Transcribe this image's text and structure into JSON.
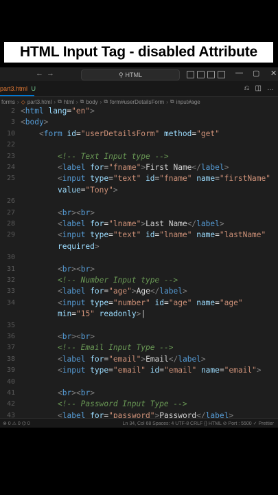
{
  "banner": {
    "title": "HTML Input Tag - disabled Attribute"
  },
  "window": {
    "search_text": "HTML",
    "back_icon": "arrow-left-icon",
    "forward_icon": "arrow-right-icon",
    "search_icon": "search-icon"
  },
  "tabs": {
    "left_label": "forms",
    "active_file": "part3.html",
    "modified": "U"
  },
  "breadcrumb": {
    "items": [
      "forms",
      "part3.html",
      "html",
      "body",
      "form#userDetailsForm",
      "input#age"
    ]
  },
  "code_lines": [
    {
      "num": "2",
      "indent": 0,
      "tokens": [
        [
          "t-punc",
          "<"
        ],
        [
          "t-tag",
          "html"
        ],
        [
          "t-plain",
          " "
        ],
        [
          "t-attr",
          "lang"
        ],
        [
          "t-plain",
          "="
        ],
        [
          "t-str",
          "\"en\""
        ],
        [
          "t-punc",
          ">"
        ]
      ]
    },
    {
      "num": "3",
      "indent": 0,
      "tokens": [
        [
          "t-punc",
          "<"
        ],
        [
          "t-tag",
          "body"
        ],
        [
          "t-punc",
          ">"
        ]
      ]
    },
    {
      "num": "10",
      "indent": 1,
      "tokens": [
        [
          "t-punc",
          "<"
        ],
        [
          "t-tag",
          "form"
        ],
        [
          "t-plain",
          " "
        ],
        [
          "t-attr",
          "id"
        ],
        [
          "t-plain",
          "="
        ],
        [
          "t-str",
          "\"userDetailsForm\""
        ],
        [
          "t-plain",
          " "
        ],
        [
          "t-attr",
          "method"
        ],
        [
          "t-plain",
          "="
        ],
        [
          "t-str",
          "\"get\""
        ]
      ]
    },
    {
      "num": "22",
      "indent": 0,
      "tokens": []
    },
    {
      "num": "23",
      "indent": 2,
      "tokens": [
        [
          "t-com",
          "<!-- Text Input type -->"
        ]
      ]
    },
    {
      "num": "24",
      "indent": 2,
      "tokens": [
        [
          "t-punc",
          "<"
        ],
        [
          "t-tag",
          "label"
        ],
        [
          "t-plain",
          " "
        ],
        [
          "t-attr",
          "for"
        ],
        [
          "t-plain",
          "="
        ],
        [
          "t-str",
          "\"fname\""
        ],
        [
          "t-punc",
          ">"
        ],
        [
          "t-plain",
          "First Name"
        ],
        [
          "t-punc",
          "</"
        ],
        [
          "t-tag",
          "label"
        ],
        [
          "t-punc",
          ">"
        ]
      ]
    },
    {
      "num": "25",
      "indent": 2,
      "tokens": [
        [
          "t-punc",
          "<"
        ],
        [
          "t-tag",
          "input"
        ],
        [
          "t-plain",
          " "
        ],
        [
          "t-attr",
          "type"
        ],
        [
          "t-plain",
          "="
        ],
        [
          "t-str",
          "\"text\""
        ],
        [
          "t-plain",
          " "
        ],
        [
          "t-attr",
          "id"
        ],
        [
          "t-plain",
          "="
        ],
        [
          "t-str",
          "\"fname\""
        ],
        [
          "t-plain",
          " "
        ],
        [
          "t-attr",
          "name"
        ],
        [
          "t-plain",
          "="
        ],
        [
          "t-str",
          "\"firstName\""
        ]
      ]
    },
    {
      "num": "",
      "indent": 2,
      "tokens": [
        [
          "t-attr",
          "value"
        ],
        [
          "t-plain",
          "="
        ],
        [
          "t-str",
          "\"Tony\""
        ],
        [
          "t-punc",
          ">"
        ]
      ]
    },
    {
      "num": "26",
      "indent": 0,
      "tokens": []
    },
    {
      "num": "27",
      "indent": 2,
      "tokens": [
        [
          "t-punc",
          "<"
        ],
        [
          "t-tag",
          "br"
        ],
        [
          "t-punc",
          "><"
        ],
        [
          "t-tag",
          "br"
        ],
        [
          "t-punc",
          ">"
        ]
      ]
    },
    {
      "num": "28",
      "indent": 2,
      "tokens": [
        [
          "t-punc",
          "<"
        ],
        [
          "t-tag",
          "label"
        ],
        [
          "t-plain",
          " "
        ],
        [
          "t-attr",
          "for"
        ],
        [
          "t-plain",
          "="
        ],
        [
          "t-str",
          "\"lname\""
        ],
        [
          "t-punc",
          ">"
        ],
        [
          "t-plain",
          "Last Name"
        ],
        [
          "t-punc",
          "</"
        ],
        [
          "t-tag",
          "label"
        ],
        [
          "t-punc",
          ">"
        ]
      ]
    },
    {
      "num": "29",
      "indent": 2,
      "tokens": [
        [
          "t-punc",
          "<"
        ],
        [
          "t-tag",
          "input"
        ],
        [
          "t-plain",
          " "
        ],
        [
          "t-attr",
          "type"
        ],
        [
          "t-plain",
          "="
        ],
        [
          "t-str",
          "\"text\""
        ],
        [
          "t-plain",
          " "
        ],
        [
          "t-attr",
          "id"
        ],
        [
          "t-plain",
          "="
        ],
        [
          "t-str",
          "\"lname\""
        ],
        [
          "t-plain",
          " "
        ],
        [
          "t-attr",
          "name"
        ],
        [
          "t-plain",
          "="
        ],
        [
          "t-str",
          "\"lastName\""
        ]
      ]
    },
    {
      "num": "",
      "indent": 2,
      "tokens": [
        [
          "t-attr",
          "required"
        ],
        [
          "t-punc",
          ">"
        ]
      ]
    },
    {
      "num": "30",
      "indent": 0,
      "tokens": []
    },
    {
      "num": "31",
      "indent": 2,
      "tokens": [
        [
          "t-punc",
          "<"
        ],
        [
          "t-tag",
          "br"
        ],
        [
          "t-punc",
          "><"
        ],
        [
          "t-tag",
          "br"
        ],
        [
          "t-punc",
          ">"
        ]
      ]
    },
    {
      "num": "32",
      "indent": 2,
      "tokens": [
        [
          "t-com",
          "<!-- Number Input type -->"
        ]
      ]
    },
    {
      "num": "33",
      "indent": 2,
      "tokens": [
        [
          "t-punc",
          "<"
        ],
        [
          "t-tag",
          "label"
        ],
        [
          "t-plain",
          " "
        ],
        [
          "t-attr",
          "for"
        ],
        [
          "t-plain",
          "="
        ],
        [
          "t-str",
          "\"age\""
        ],
        [
          "t-punc",
          ">"
        ],
        [
          "t-plain",
          "Age"
        ],
        [
          "t-punc",
          "</"
        ],
        [
          "t-tag",
          "label"
        ],
        [
          "t-punc",
          ">"
        ]
      ]
    },
    {
      "num": "34",
      "indent": 2,
      "tokens": [
        [
          "t-punc",
          "<"
        ],
        [
          "t-tag",
          "input"
        ],
        [
          "t-plain",
          " "
        ],
        [
          "t-attr",
          "type"
        ],
        [
          "t-plain",
          "="
        ],
        [
          "t-str",
          "\"number\""
        ],
        [
          "t-plain",
          " "
        ],
        [
          "t-attr",
          "id"
        ],
        [
          "t-plain",
          "="
        ],
        [
          "t-str",
          "\"age\""
        ],
        [
          "t-plain",
          " "
        ],
        [
          "t-attr",
          "name"
        ],
        [
          "t-plain",
          "="
        ],
        [
          "t-str",
          "\"age\""
        ]
      ]
    },
    {
      "num": "",
      "indent": 2,
      "tokens": [
        [
          "t-attr",
          "min"
        ],
        [
          "t-plain",
          "="
        ],
        [
          "t-str",
          "\"15\""
        ],
        [
          "t-plain",
          " "
        ],
        [
          "t-attr",
          "readonly"
        ],
        [
          "t-punc",
          ">"
        ],
        [
          "t-plain",
          "|"
        ]
      ]
    },
    {
      "num": "35",
      "indent": 0,
      "tokens": []
    },
    {
      "num": "36",
      "indent": 2,
      "tokens": [
        [
          "t-punc",
          "<"
        ],
        [
          "t-tag",
          "br"
        ],
        [
          "t-punc",
          "><"
        ],
        [
          "t-tag",
          "br"
        ],
        [
          "t-punc",
          ">"
        ]
      ]
    },
    {
      "num": "37",
      "indent": 2,
      "tokens": [
        [
          "t-com",
          "<!-- Email Input Type -->"
        ]
      ]
    },
    {
      "num": "38",
      "indent": 2,
      "tokens": [
        [
          "t-punc",
          "<"
        ],
        [
          "t-tag",
          "label"
        ],
        [
          "t-plain",
          " "
        ],
        [
          "t-attr",
          "for"
        ],
        [
          "t-plain",
          "="
        ],
        [
          "t-str",
          "\"email\""
        ],
        [
          "t-punc",
          ">"
        ],
        [
          "t-plain",
          "Email"
        ],
        [
          "t-punc",
          "</"
        ],
        [
          "t-tag",
          "label"
        ],
        [
          "t-punc",
          ">"
        ]
      ]
    },
    {
      "num": "39",
      "indent": 2,
      "tokens": [
        [
          "t-punc",
          "<"
        ],
        [
          "t-tag",
          "input"
        ],
        [
          "t-plain",
          " "
        ],
        [
          "t-attr",
          "type"
        ],
        [
          "t-plain",
          "="
        ],
        [
          "t-str",
          "\"email\""
        ],
        [
          "t-plain",
          " "
        ],
        [
          "t-attr",
          "id"
        ],
        [
          "t-plain",
          "="
        ],
        [
          "t-str",
          "\"email\""
        ],
        [
          "t-plain",
          " "
        ],
        [
          "t-attr",
          "name"
        ],
        [
          "t-plain",
          "="
        ],
        [
          "t-str",
          "\"email\""
        ],
        [
          "t-punc",
          ">"
        ]
      ]
    },
    {
      "num": "40",
      "indent": 0,
      "tokens": []
    },
    {
      "num": "41",
      "indent": 2,
      "tokens": [
        [
          "t-punc",
          "<"
        ],
        [
          "t-tag",
          "br"
        ],
        [
          "t-punc",
          "><"
        ],
        [
          "t-tag",
          "br"
        ],
        [
          "t-punc",
          ">"
        ]
      ]
    },
    {
      "num": "42",
      "indent": 2,
      "tokens": [
        [
          "t-com",
          "<!-- Password Input Type -->"
        ]
      ]
    },
    {
      "num": "43",
      "indent": 2,
      "tokens": [
        [
          "t-punc",
          "<"
        ],
        [
          "t-tag",
          "label"
        ],
        [
          "t-plain",
          " "
        ],
        [
          "t-attr",
          "for"
        ],
        [
          "t-plain",
          "="
        ],
        [
          "t-str",
          "\"password\""
        ],
        [
          "t-punc",
          ">"
        ],
        [
          "t-plain",
          "Password"
        ],
        [
          "t-punc",
          "</"
        ],
        [
          "t-tag",
          "label"
        ],
        [
          "t-punc",
          ">"
        ]
      ]
    }
  ],
  "status": {
    "left": "⊗ 0 ⚠ 0  ⌬ 0",
    "right": "Ln 34, Col 68   Spaces: 4   UTF-8   CRLF   {} HTML   ⊘ Port : 5500   ✓ Prettier"
  }
}
